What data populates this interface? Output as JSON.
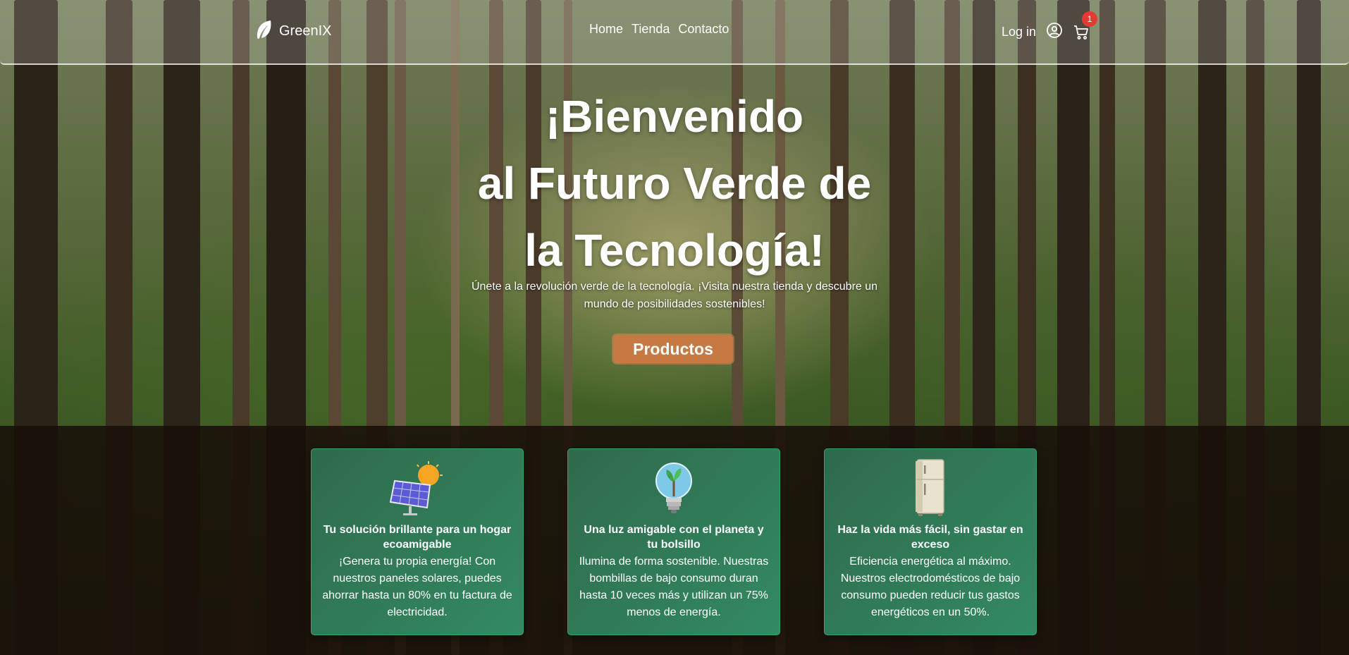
{
  "header": {
    "brand": "GreenIX",
    "nav": [
      "Home",
      "Tienda",
      "Contacto"
    ],
    "login_label": "Log in",
    "cart_count": "1",
    "icons": {
      "logo": "leaf-icon",
      "user": "user-circle-icon",
      "cart": "cart-icon"
    }
  },
  "hero": {
    "title_lines": [
      "¡Bienvenido",
      "al Futuro Verde de",
      "la Tecnología!"
    ],
    "subtitle": "Únete a la revolución verde de la tecnología. ¡Visita nuestra tienda y descubre un mundo de posibilidades sostenibles!",
    "cta_label": "Productos"
  },
  "features": [
    {
      "icon": "solar-panel-icon",
      "title": "Tu solución brillante para un hogar ecoamigable",
      "body": "¡Genera tu propia energía! Con nuestros paneles solares, puedes ahorrar hasta un 80% en tu factura de electricidad."
    },
    {
      "icon": "eco-bulb-icon",
      "title": "Una luz amigable con el planeta y tu bolsillo",
      "body": "Ilumina de forma sostenible. Nuestras bombillas de bajo consumo duran hasta 10 veces más y utilizan un 75% menos de energía."
    },
    {
      "icon": "refrigerator-icon",
      "title": "Haz la vida más fácil, sin gastar en exceso",
      "body": "Eficiencia energética al máximo. Nuestros electrodomésticos de bajo consumo pueden reducir tus gastos energéticos en un 50%."
    }
  ],
  "colors": {
    "accent": "#c47a42",
    "card": "#328a62",
    "badge": "#e53935",
    "overlay": "#180f08"
  }
}
